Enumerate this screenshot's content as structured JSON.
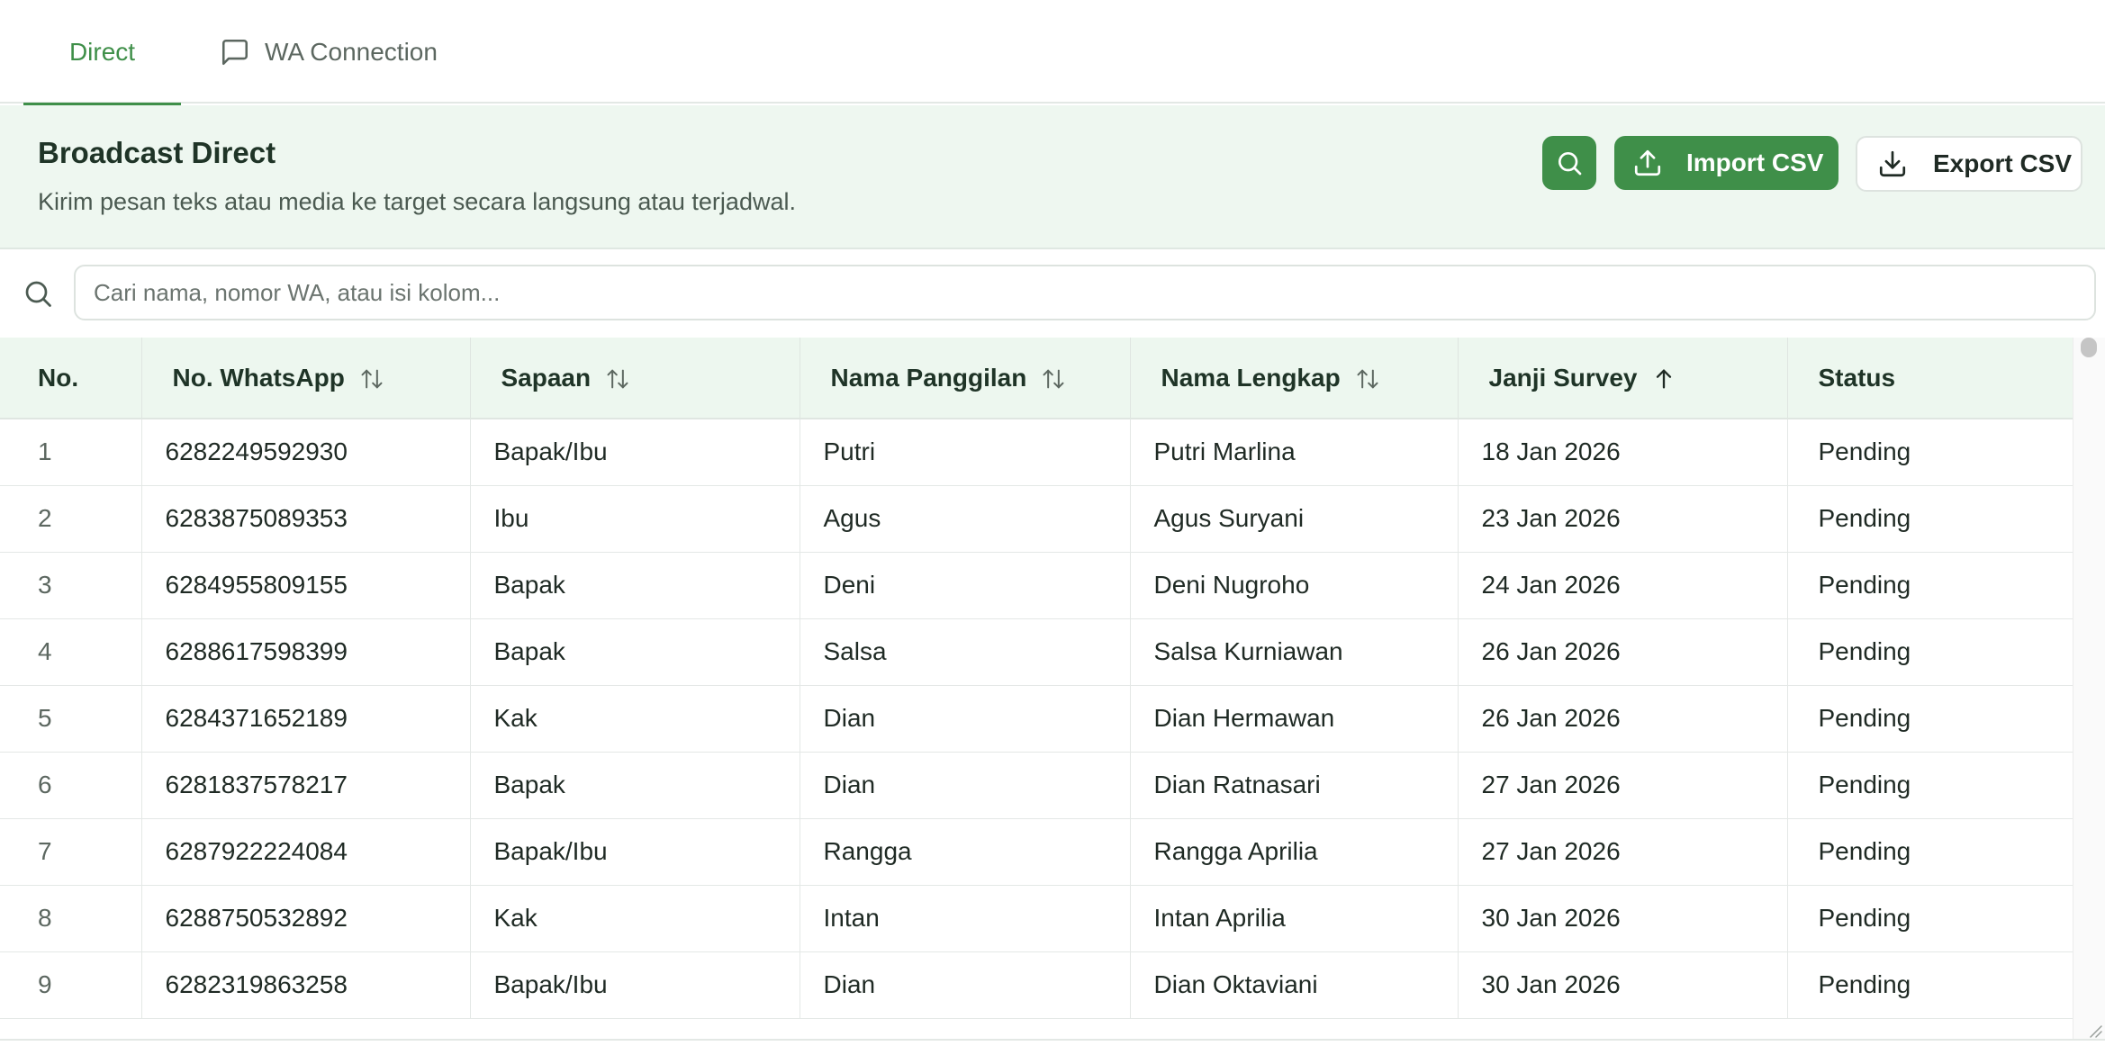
{
  "tabs": [
    {
      "label": "Direct",
      "active": true
    },
    {
      "label": "WA Connection",
      "icon": "message-square-icon",
      "active": false
    }
  ],
  "header": {
    "title": "Broadcast Direct",
    "subtitle": "Kirim pesan teks atau media ke target secara langsung atau terjadwal.",
    "search_button_icon": "search-icon",
    "import_label": "Import CSV",
    "export_label": "Export CSV"
  },
  "search": {
    "placeholder": "Cari nama, nomor WA, atau isi kolom..."
  },
  "colors": {
    "accent": "#3f8f49",
    "header_bg": "#eef7f0"
  },
  "table": {
    "columns": [
      {
        "label": "No.",
        "sort": "none"
      },
      {
        "label": "No. WhatsApp",
        "sort": "both"
      },
      {
        "label": "Sapaan",
        "sort": "both"
      },
      {
        "label": "Nama Panggilan",
        "sort": "both"
      },
      {
        "label": "Nama Lengkap",
        "sort": "both"
      },
      {
        "label": "Janji Survey",
        "sort": "asc"
      },
      {
        "label": "Status",
        "sort": "none"
      }
    ],
    "rows": [
      [
        "1",
        "6282249592930",
        "Bapak/Ibu",
        "Putri",
        "Putri Marlina",
        "18 Jan 2026",
        "Pending"
      ],
      [
        "2",
        "6283875089353",
        "Ibu",
        "Agus",
        "Agus Suryani",
        "23 Jan 2026",
        "Pending"
      ],
      [
        "3",
        "6284955809155",
        "Bapak",
        "Deni",
        "Deni Nugroho",
        "24 Jan 2026",
        "Pending"
      ],
      [
        "4",
        "6288617598399",
        "Bapak",
        "Salsa",
        "Salsa Kurniawan",
        "26 Jan 2026",
        "Pending"
      ],
      [
        "5",
        "6284371652189",
        "Kak",
        "Dian",
        "Dian Hermawan",
        "26 Jan 2026",
        "Pending"
      ],
      [
        "6",
        "6281837578217",
        "Bapak",
        "Dian",
        "Dian Ratnasari",
        "27 Jan 2026",
        "Pending"
      ],
      [
        "7",
        "6287922224084",
        "Bapak/Ibu",
        "Rangga",
        "Rangga Aprilia",
        "27 Jan 2026",
        "Pending"
      ],
      [
        "8",
        "6288750532892",
        "Kak",
        "Intan",
        "Intan Aprilia",
        "30 Jan 2026",
        "Pending"
      ],
      [
        "9",
        "6282319863258",
        "Bapak/Ibu",
        "Dian",
        "Dian Oktaviani",
        "30 Jan 2026",
        "Pending"
      ]
    ]
  }
}
